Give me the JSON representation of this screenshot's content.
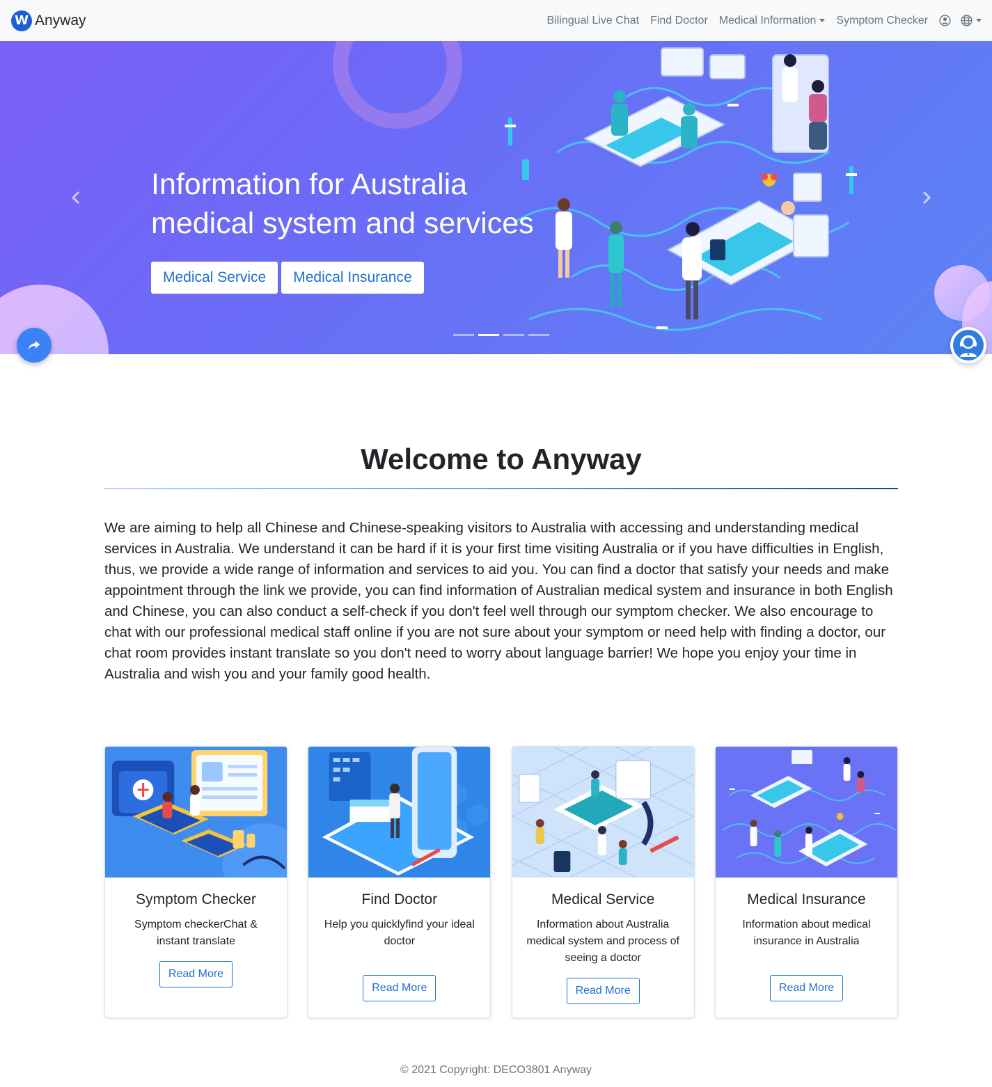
{
  "nav": {
    "brand_logo_letter": "W",
    "brand": "Anyway",
    "links": [
      "Bilingual Live Chat",
      "Find Doctor",
      "Medical Information",
      "Symptom Checker"
    ],
    "user_icon": "user-circle-icon",
    "language_icon": "globe-icon"
  },
  "hero": {
    "title_line1": "Information for Australia",
    "title_line2": "medical system and services",
    "buttons": [
      "Medical Service",
      "Medical Insurance"
    ],
    "slide_count": 4,
    "active_slide": 2,
    "prev_icon": "chevron-left-icon",
    "next_icon": "chevron-right-icon"
  },
  "floating": {
    "share_icon": "share-arrow-icon",
    "chat_icon": "support-agent-icon"
  },
  "welcome": {
    "title": "Welcome to Anyway",
    "text": "We are aiming to help all Chinese and Chinese-speaking visitors to Australia with accessing and understanding medical services in Australia. We understand it can be hard if it is your first time visiting Australia or if you have difficulties in English, thus, we provide a wide range of information and services to aid you. You can find a doctor that satisfy your needs and make appointment through the link we provide, you can find information of Australian medical system and insurance in both English and Chinese, you can also conduct a self-check if you don't feel well through our symptom checker. We also encourage to chat with our professional medical staff online if you are not sure about your symptom or need help with finding a doctor, our chat room provides instant translate so you don't need to worry about language barrier! We hope you enjoy your time in Australia and wish you and your family good health."
  },
  "cards": [
    {
      "title": "Symptom Checker",
      "text": "Symptom checkerChat & instant translate",
      "button": "Read More"
    },
    {
      "title": "Find Doctor",
      "text": "Help you quicklyfind your ideal doctor",
      "button": "Read More"
    },
    {
      "title": "Medical Service",
      "text": "Information about Australia medical system and process of seeing a doctor",
      "button": "Read More"
    },
    {
      "title": "Medical Insurance",
      "text": "Information about medical insurance in Australia",
      "button": "Read More"
    }
  ],
  "footer": {
    "text": "© 2021 Copyright: DECO3801 Anyway"
  },
  "colors": {
    "primary": "#1e6fd0",
    "hero_start": "#7c5ff5",
    "hero_end": "#5b85f5",
    "navbar_bg": "#f8f9fa"
  }
}
